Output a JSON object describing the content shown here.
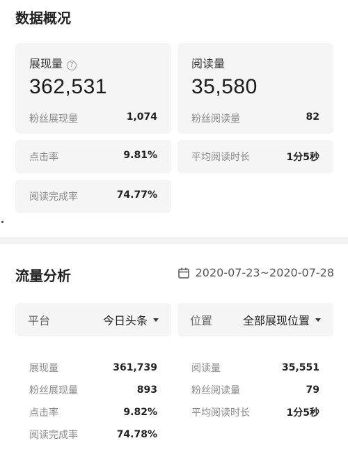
{
  "overview": {
    "title": "数据概况",
    "impressions": {
      "label": "展现量",
      "value": "362,531",
      "sub_label": "粉丝展现量",
      "sub_value": "1,074"
    },
    "reads": {
      "label": "阅读量",
      "value": "35,580",
      "sub_label": "粉丝阅读量",
      "sub_value": "82"
    },
    "ctr": {
      "label": "点击率",
      "value": "9.81%"
    },
    "avg_read_time": {
      "label": "平均阅读时长",
      "value": "1分5秒"
    },
    "completion": {
      "label": "阅读完成率",
      "value": "74.77%"
    },
    "help_icon": "question-circle-icon"
  },
  "traffic": {
    "title": "流量分析",
    "date_range": "2020-07-23~2020-07-28",
    "calendar_icon": "calendar-icon",
    "platform": {
      "label": "平台",
      "value": "今日头条"
    },
    "position": {
      "label": "位置",
      "value": "全部展现位置"
    },
    "left_stats": [
      {
        "label": "展现量",
        "value": "361,739"
      },
      {
        "label": "粉丝展现量",
        "value": "893"
      },
      {
        "label": "点击率",
        "value": "9.82%"
      },
      {
        "label": "阅读完成率",
        "value": "74.78%"
      }
    ],
    "right_stats": [
      {
        "label": "阅读量",
        "value": "35,551"
      },
      {
        "label": "粉丝阅读量",
        "value": "79"
      },
      {
        "label": "平均阅读时长",
        "value": "1分5秒"
      }
    ]
  },
  "colors": {
    "card_bg": "#f5f5f5",
    "text": "#222222",
    "muted": "#888888"
  }
}
